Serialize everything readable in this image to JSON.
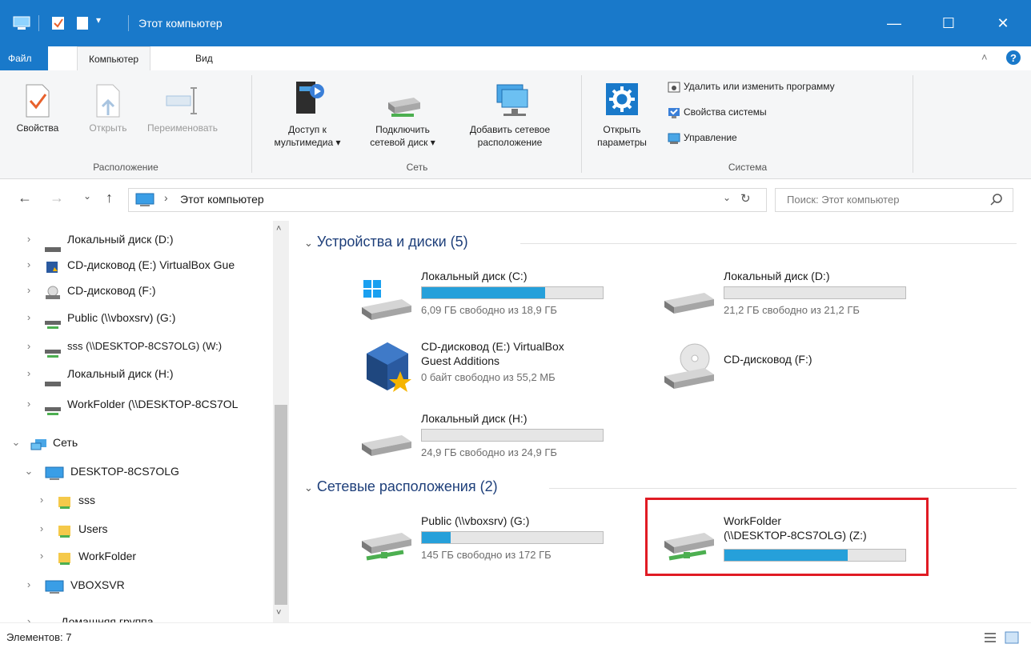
{
  "window": {
    "title": "Этот компьютер"
  },
  "ribbon": {
    "tabs": {
      "file": "Файл",
      "computer": "Компьютер",
      "view": "Вид"
    },
    "location": {
      "properties": "Свойства",
      "open": "Открыть",
      "rename": "Переименовать",
      "group": "Расположение"
    },
    "network": {
      "media_line1": "Доступ к",
      "media_line2": "мультимедиа ▾",
      "map_line1": "Подключить",
      "map_line2": "сетевой диск ▾",
      "add_line1": "Добавить сетевое",
      "add_line2": "расположение",
      "group": "Сеть"
    },
    "system": {
      "open_line1": "Открыть",
      "open_line2": "параметры",
      "uninstall": "Удалить или изменить программу",
      "sysprops": "Свойства системы",
      "manage": "Управление",
      "group": "Система"
    }
  },
  "address": {
    "path": "Этот компьютер",
    "search_placeholder": "Поиск: Этот компьютер"
  },
  "nav": {
    "items": [
      {
        "label": "Локальный диск (D:)"
      },
      {
        "label": "CD-дисковод (E:) VirtualBox Gue"
      },
      {
        "label": "CD-дисковод (F:)"
      },
      {
        "label": "Public (\\\\vboxsrv) (G:)"
      },
      {
        "label": "sss (\\\\DESKTOP-8CS7OLG) (W:)"
      },
      {
        "label": "Локальный диск (H:)"
      },
      {
        "label": "WorkFolder (\\\\DESKTOP-8CS7OL"
      },
      {
        "label": "Сеть"
      },
      {
        "label": "DESKTOP-8CS7OLG"
      },
      {
        "label": "sss"
      },
      {
        "label": "Users"
      },
      {
        "label": "WorkFolder"
      },
      {
        "label": "VBOXSVR"
      },
      {
        "label": "Домашняя группа"
      }
    ]
  },
  "content": {
    "devices_header": "Устройства и диски (5)",
    "network_header": "Сетевые расположения (2)",
    "drives": [
      {
        "name": "Локальный диск (C:)",
        "free": "6,09 ГБ свободно из 18,9 ГБ",
        "used_fraction": 0.68
      },
      {
        "name": "Локальный диск (D:)",
        "free": "21,2 ГБ свободно из 21,2 ГБ",
        "used_fraction": 0.0
      },
      {
        "name_line1": "CD-дисковод (E:) VirtualBox",
        "name_line2": "Guest Additions",
        "free": "0 байт свободно из 55,2 МБ"
      },
      {
        "name": "CD-дисковод (F:)"
      },
      {
        "name": "Локальный диск (H:)",
        "free": "24,9 ГБ свободно из 24,9 ГБ",
        "used_fraction": 0.0
      }
    ],
    "network_locations": [
      {
        "name": "Public (\\\\vboxsrv) (G:)",
        "free": "145 ГБ свободно из 172 ГБ",
        "used_fraction": 0.16
      },
      {
        "name_line1": "WorkFolder",
        "name_line2": "(\\\\DESKTOP-8CS7OLG) (Z:)",
        "used_fraction": 0.68
      }
    ]
  },
  "status": {
    "items": "Элементов: 7"
  },
  "colors": {
    "accent": "#1979ca",
    "bar_fill": "#26a0da",
    "highlight": "#e01b24"
  }
}
